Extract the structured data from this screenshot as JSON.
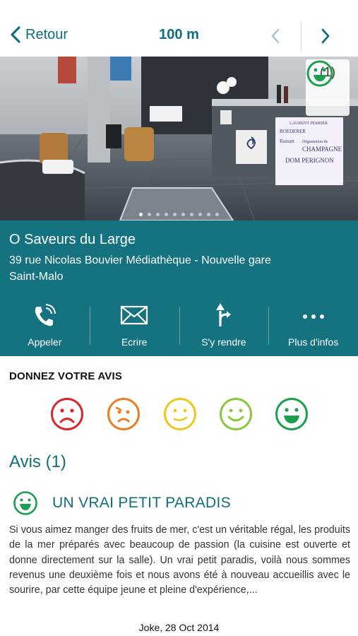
{
  "nav": {
    "back_label": "Retour",
    "distance": "100 m",
    "accent": "#0f6e7e"
  },
  "photo": {
    "rating_count": "(1)",
    "slide_count": 10,
    "active_slide": 0,
    "signage": {
      "line1": "LAURENT PERRIER",
      "line2": "ROEDERER",
      "line3": "Ruinart",
      "line4": "Dégustation de",
      "line5": "CHAMPAGNE",
      "line6": "DOM PERIGNON"
    }
  },
  "place": {
    "name": "O Saveurs du Large",
    "address_line1": "39 rue Nicolas Bouvier  Médiathèque - Nouvelle gare",
    "address_line2": "Saint-Malo",
    "panel_color": "#147281"
  },
  "actions": [
    {
      "icon": "phone-icon",
      "label": "Appeler"
    },
    {
      "icon": "envelope-icon",
      "label": "Ecrire"
    },
    {
      "icon": "directions-icon",
      "label": "S'y rendre"
    },
    {
      "icon": "more-icon",
      "label": "Plus d'infos"
    }
  ],
  "rate": {
    "title": "DONNEZ VOTRE AVIS",
    "options": [
      {
        "name": "very-bad",
        "color": "#d9262c"
      },
      {
        "name": "bad",
        "color": "#ec7d22"
      },
      {
        "name": "neutral",
        "color": "#ecc81f"
      },
      {
        "name": "good",
        "color": "#8cc63e"
      },
      {
        "name": "very-good",
        "color": "#1d9f4f"
      }
    ]
  },
  "reviews": {
    "title": "Avis (1)",
    "items": [
      {
        "title": "UN VRAI PETIT PARADIS",
        "rating": "very-good",
        "text": "Si vous aimez manger des fruits de mer, c'est un véritable régal, les produits de la mer préparés avec beaucoup de passion (la cuisine est ouverte et donne directement sur la salle). Un vrai petit paradis, voilà nous sommes revenus une deuxième fois et nous avons été à nouveau accueillis avec le sourire, par cette équipe jeune et pleine d'expérience,...",
        "author": "Joke, 28 Oct 2014"
      }
    ]
  }
}
